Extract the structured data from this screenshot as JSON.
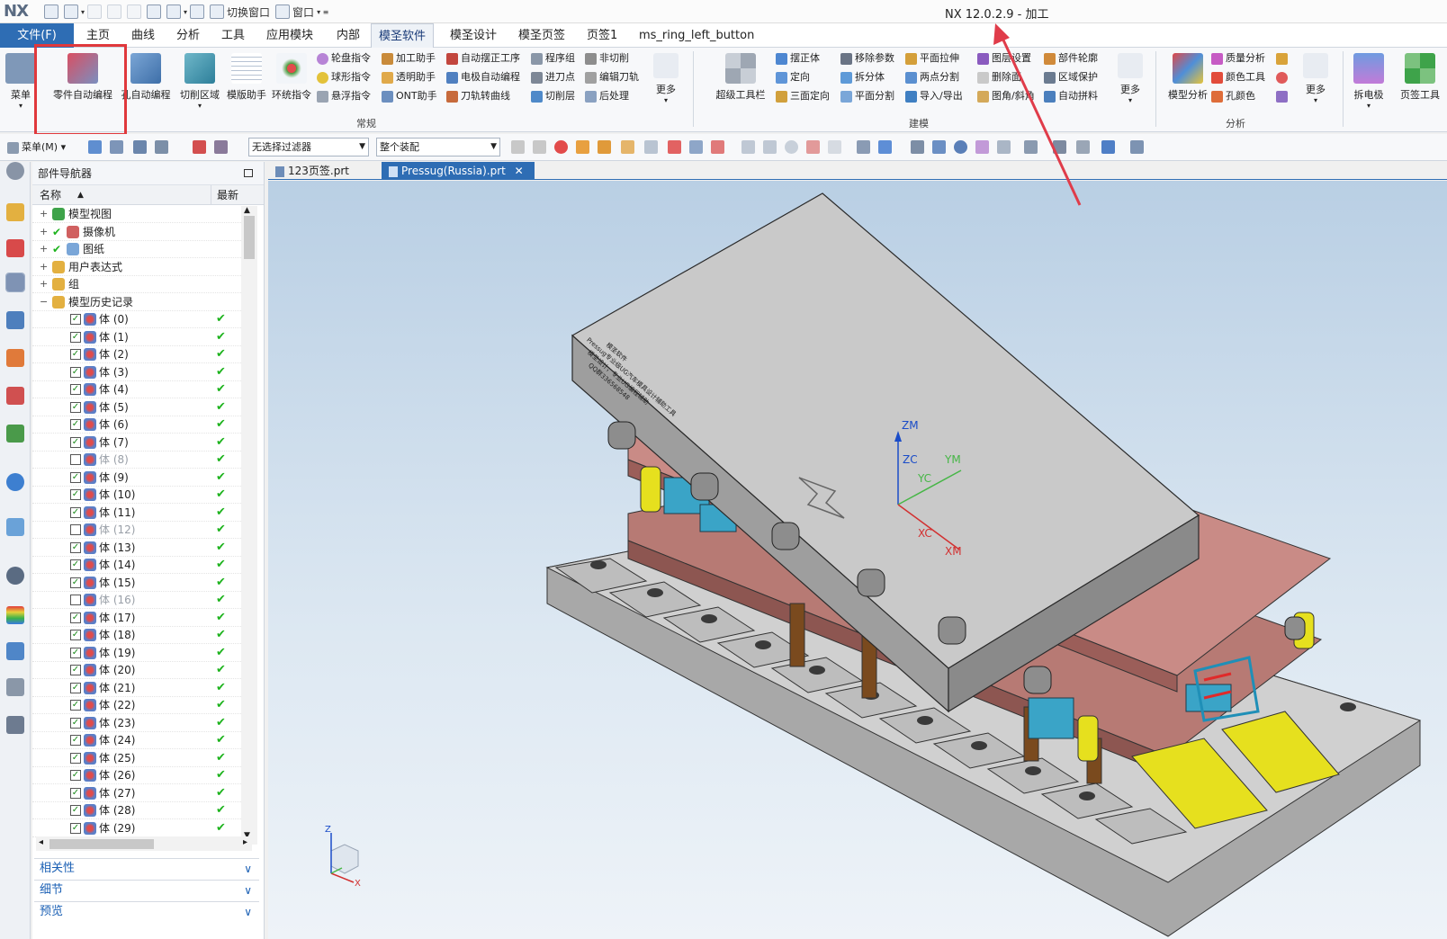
{
  "title_bar": {
    "logo": "NX",
    "switch_window": "切换窗口",
    "window_menu": "窗口",
    "app_title": "NX 12.0.2.9 - 加工"
  },
  "tabs": [
    "文件(F)",
    "主页",
    "曲线",
    "分析",
    "工具",
    "应用模块",
    "内部",
    "模圣软件",
    "模圣设计",
    "模圣页签",
    "页签1",
    "ms_ring_left_button"
  ],
  "active_tab": "模圣软件",
  "ribbon": {
    "menu_label": "菜单",
    "big_buttons": [
      "零件自动编程",
      "孔自动编程",
      "切削区域",
      "模版助手",
      "环统指令"
    ],
    "col1": [
      "轮盘指令",
      "球形指令",
      "悬浮指令"
    ],
    "col2": [
      "加工助手",
      "透明助手",
      "ONT助手"
    ],
    "col3": [
      "自动摆正工序",
      "电极自动编程",
      "刀轨转曲线"
    ],
    "col4": [
      "程序组",
      "进刀点",
      "切削层"
    ],
    "col5": [
      "非切削",
      "编辑刀轨",
      "后处理"
    ],
    "more1": "更多",
    "group_common": "常规",
    "super_toolbar": "超级工具栏",
    "col6": [
      "摆正体",
      "定向",
      "三面定向"
    ],
    "col7": [
      "移除参数",
      "拆分体",
      "平面分割"
    ],
    "col8": [
      "平面拉伸",
      "两点分割",
      "导入/导出"
    ],
    "col9": [
      "图层设置",
      "删除面",
      "图角/斜角"
    ],
    "col10": [
      "部件轮廓",
      "区域保护",
      "自动拼料"
    ],
    "more2": "更多",
    "group_model": "建模",
    "model_analysis": "模型分析",
    "col11": [
      "质量分析",
      "颜色工具",
      "孔颜色"
    ],
    "more3": "更多",
    "group_analysis": "分析",
    "split_electrode": "拆电极",
    "tab_tool": "页签工具"
  },
  "toolbar2": {
    "menu": "菜单(M)",
    "filter": "无选择过滤器",
    "assembly": "整个装配"
  },
  "navigator": {
    "title": "部件导航器",
    "col_name": "名称",
    "col_latest": "最新",
    "tree": [
      {
        "label": "模型视图",
        "indent": 0,
        "check": false
      },
      {
        "label": "摄像机",
        "indent": 0,
        "check": true
      },
      {
        "label": "图纸",
        "indent": 0,
        "check": true
      },
      {
        "label": "用户表达式",
        "indent": 0,
        "check": false
      },
      {
        "label": "组",
        "indent": 0,
        "check": false
      },
      {
        "label": "模型历史记录",
        "indent": 0,
        "check": false
      }
    ],
    "bodies": [
      {
        "label": "体 (0)",
        "on": true
      },
      {
        "label": "体 (1)",
        "on": true
      },
      {
        "label": "体 (2)",
        "on": true
      },
      {
        "label": "体 (3)",
        "on": true
      },
      {
        "label": "体 (4)",
        "on": true
      },
      {
        "label": "体 (5)",
        "on": true
      },
      {
        "label": "体 (6)",
        "on": true
      },
      {
        "label": "体 (7)",
        "on": true
      },
      {
        "label": "体 (8)",
        "on": false
      },
      {
        "label": "体 (9)",
        "on": true
      },
      {
        "label": "体 (10)",
        "on": true
      },
      {
        "label": "体 (11)",
        "on": true
      },
      {
        "label": "体 (12)",
        "on": false
      },
      {
        "label": "体 (13)",
        "on": true
      },
      {
        "label": "体 (14)",
        "on": true
      },
      {
        "label": "体 (15)",
        "on": true
      },
      {
        "label": "体 (16)",
        "on": false
      },
      {
        "label": "体 (17)",
        "on": true
      },
      {
        "label": "体 (18)",
        "on": true
      },
      {
        "label": "体 (19)",
        "on": true
      },
      {
        "label": "体 (20)",
        "on": true
      },
      {
        "label": "体 (21)",
        "on": true
      },
      {
        "label": "体 (22)",
        "on": true
      },
      {
        "label": "体 (23)",
        "on": true
      },
      {
        "label": "体 (24)",
        "on": true
      },
      {
        "label": "体 (25)",
        "on": true
      },
      {
        "label": "体 (26)",
        "on": true
      },
      {
        "label": "体 (27)",
        "on": true
      },
      {
        "label": "体 (28)",
        "on": true
      },
      {
        "label": "体 (29)",
        "on": true
      }
    ],
    "accordion": [
      "相关性",
      "细节",
      "预览"
    ]
  },
  "doc_tabs": [
    "123页签.prt",
    "Pressug(Russia).prt"
  ],
  "viewport": {
    "axes": {
      "zm": "ZM",
      "zc": "ZC",
      "yc": "YC",
      "ym": "YM",
      "xc": "XC",
      "xm": "XM"
    },
    "triad": {
      "z": "Z",
      "x": "X"
    },
    "plate_text": [
      "模圣软件",
      "Pressug专业级UG汽车模具设计辅助工具",
      "模圣设计，专业UG编程辅助",
      "QQ群336568548"
    ]
  },
  "colors": {
    "accent": "#2e6db4",
    "highlight_box": "#e0383c",
    "top_plate": "#c9c9c9",
    "pink_plate": "#c98b86",
    "yellow": "#e6e01e",
    "cyan": "#3aa4c7"
  }
}
